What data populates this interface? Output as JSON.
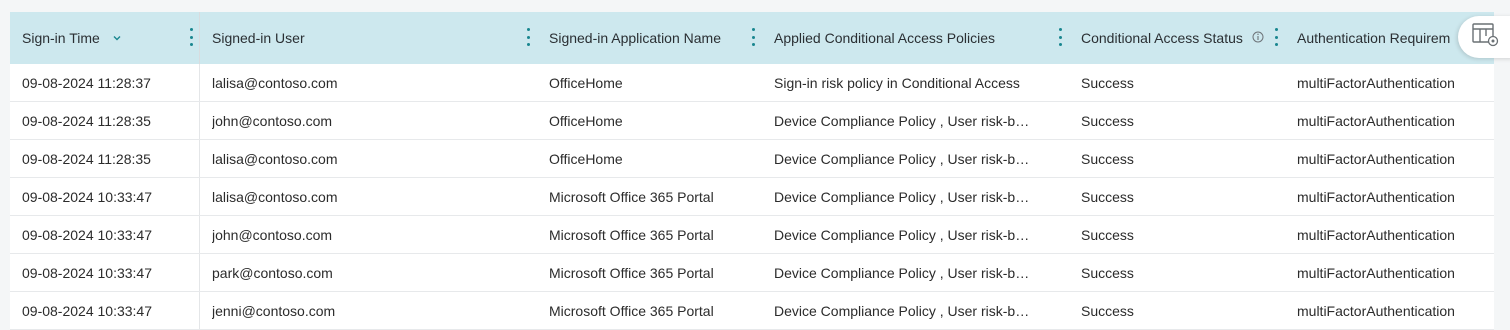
{
  "table": {
    "columns": [
      {
        "label": "Sign-in Time",
        "sortable": true,
        "icon": "chevron-down-icon"
      },
      {
        "label": "Signed-in User"
      },
      {
        "label": "Signed-in Application Name"
      },
      {
        "label": "Applied Conditional Access Policies"
      },
      {
        "label": "Conditional Access Status",
        "info_icon": "info-icon"
      },
      {
        "label": "Authentication Requirem"
      }
    ],
    "rows": [
      [
        "09-08-2024 11:28:37",
        "lalisa@contoso.com",
        "OfficeHome",
        "Sign-in risk policy in Conditional Access",
        "Success",
        "multiFactorAuthentication"
      ],
      [
        "09-08-2024 11:28:35",
        "john@contoso.com",
        "OfficeHome",
        "Device Compliance Policy , User risk-based policy",
        "Success",
        "multiFactorAuthentication"
      ],
      [
        "09-08-2024 11:28:35",
        "lalisa@contoso.com",
        "OfficeHome",
        "Device Compliance Policy , User risk-based policy",
        "Success",
        "multiFactorAuthentication"
      ],
      [
        "09-08-2024 10:33:47",
        "lalisa@contoso.com",
        "Microsoft Office 365 Portal",
        "Device Compliance Policy , User risk-based policy",
        "Success",
        "multiFactorAuthentication"
      ],
      [
        "09-08-2024 10:33:47",
        "john@contoso.com",
        "Microsoft Office 365 Portal",
        "Device Compliance Policy , User risk-based policy",
        "Success",
        "multiFactorAuthentication"
      ],
      [
        "09-08-2024 10:33:47",
        "park@contoso.com",
        "Microsoft Office 365 Portal",
        "Device Compliance Policy , User risk-based policy",
        "Success",
        "multiFactorAuthentication"
      ],
      [
        "09-08-2024 10:33:47",
        "jenni@contoso.com",
        "Microsoft Office 365 Portal",
        "Device Compliance Policy , User risk-based policy",
        "Success",
        "multiFactorAuthentication"
      ]
    ]
  },
  "column_settings_button": {
    "icon": "table-settings-icon"
  },
  "colors": {
    "header_bg": "#cde8ee",
    "accent": "#19868f",
    "row_border": "#e7e9eb"
  }
}
